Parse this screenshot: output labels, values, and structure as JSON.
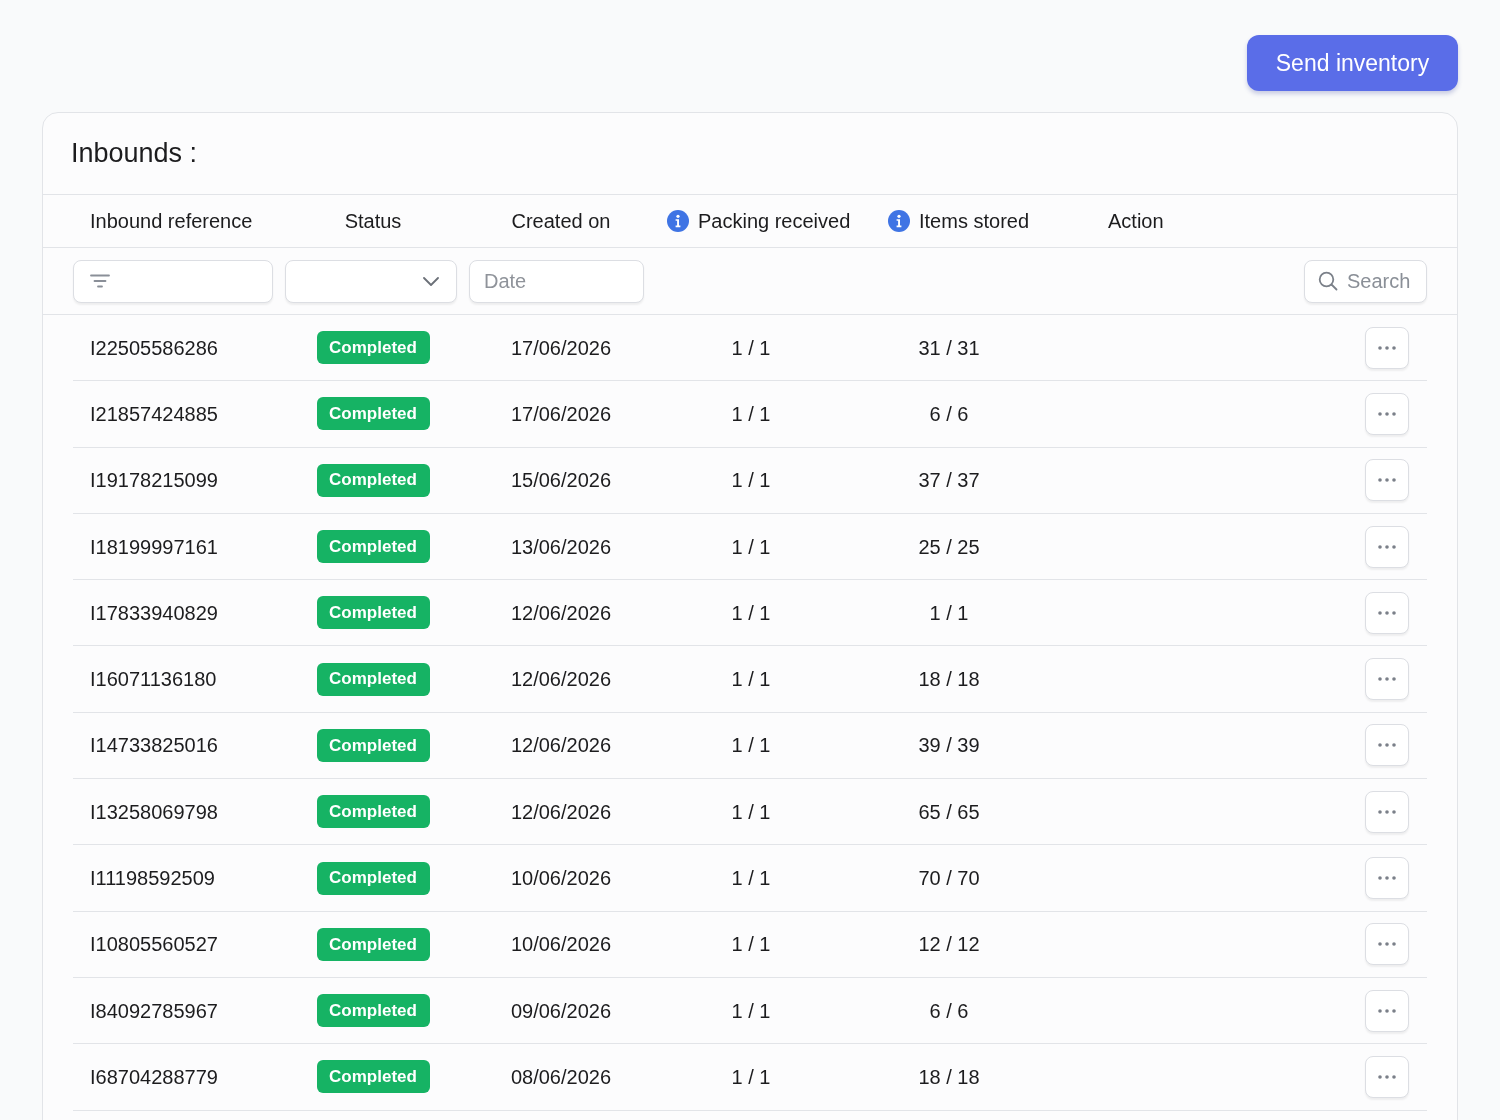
{
  "send_button": {
    "label": "Send inventory"
  },
  "card": {
    "title": "Inbounds :",
    "columns": [
      {
        "label": "Inbound reference",
        "info": false
      },
      {
        "label": "Status",
        "info": false
      },
      {
        "label": "Created on",
        "info": false
      },
      {
        "label": "Packing received",
        "info": true
      },
      {
        "label": "Items stored",
        "info": true
      },
      {
        "label": "Action",
        "info": false
      }
    ],
    "filters": [
      {
        "kind": "text"
      },
      {
        "kind": "select"
      },
      {
        "kind": "date",
        "placeholder": "Date"
      }
    ],
    "search": {
      "placeholder": "Search"
    },
    "rows": [
      {
        "reference": "I22505586286",
        "status": "Completed",
        "created_on": "17/06/2026",
        "packing_received": "1 / 1",
        "items_stored": "31 / 31"
      },
      {
        "reference": "I21857424885",
        "status": "Completed",
        "created_on": "17/06/2026",
        "packing_received": "1 / 1",
        "items_stored": "6 / 6"
      },
      {
        "reference": "I19178215099",
        "status": "Completed",
        "created_on": "15/06/2026",
        "packing_received": "1 / 1",
        "items_stored": "37 / 37"
      },
      {
        "reference": "I18199997161",
        "status": "Completed",
        "created_on": "13/06/2026",
        "packing_received": "1 / 1",
        "items_stored": "25 / 25"
      },
      {
        "reference": "I17833940829",
        "status": "Completed",
        "created_on": "12/06/2026",
        "packing_received": "1 / 1",
        "items_stored": "1 / 1"
      },
      {
        "reference": "I16071136180",
        "status": "Completed",
        "created_on": "12/06/2026",
        "packing_received": "1 / 1",
        "items_stored": "18 / 18"
      },
      {
        "reference": "I14733825016",
        "status": "Completed",
        "created_on": "12/06/2026",
        "packing_received": "1 / 1",
        "items_stored": "39 / 39"
      },
      {
        "reference": "I13258069798",
        "status": "Completed",
        "created_on": "12/06/2026",
        "packing_received": "1 / 1",
        "items_stored": "65 / 65"
      },
      {
        "reference": "I11198592509",
        "status": "Completed",
        "created_on": "10/06/2026",
        "packing_received": "1 / 1",
        "items_stored": "70 / 70"
      },
      {
        "reference": "I10805560527",
        "status": "Completed",
        "created_on": "10/06/2026",
        "packing_received": "1 / 1",
        "items_stored": "12 / 12"
      },
      {
        "reference": "I84092785967",
        "status": "Completed",
        "created_on": "09/06/2026",
        "packing_received": "1 / 1",
        "items_stored": "6 / 6"
      },
      {
        "reference": "I68704288779",
        "status": "Completed",
        "created_on": "08/06/2026",
        "packing_received": "1 / 1",
        "items_stored": "18 / 18"
      }
    ]
  }
}
